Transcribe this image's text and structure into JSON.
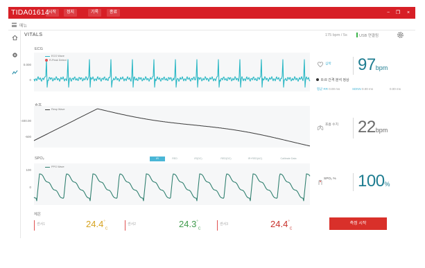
{
  "window": {
    "title": "TIDA01614",
    "menu": [
      "시작",
      "정지",
      "기록",
      "종료"
    ],
    "buttons": [
      "−",
      "❐",
      "×"
    ]
  },
  "toolbar": {
    "menu_label": "메뉴"
  },
  "header": {
    "title": "VITALS",
    "info": "175 bpm / 5s",
    "status": "USB 연결됨"
  },
  "nav_icons": [
    "home-icon",
    "settings-icon",
    "chart-icon"
  ],
  "colors": {
    "accent_red": "#d71f26",
    "ecg": "#29b7c4",
    "resp": "#3a3a3a",
    "spo2": "#2f7f6f",
    "teal": "#2a8fa9"
  },
  "ecg": {
    "label": "ECG",
    "legend": [
      "ECG Wave",
      "R-Peak Detect"
    ],
    "yticks": [
      "0.000",
      "0"
    ]
  },
  "resp": {
    "label": "호흡",
    "legend": [
      "Resp Wave"
    ],
    "yticks": [
      "-400.00",
      "-600"
    ]
  },
  "spo2": {
    "label": "SPO₂",
    "legend": [
      "PPG Wave"
    ],
    "yticks": [
      "100",
      "0"
    ],
    "tabs": [
      "IR",
      "RED",
      "IR(DC)",
      "RED(DC)",
      "IR+RED(AC)",
      "Calibrate Data"
    ]
  },
  "heart_rate": {
    "label": "심박",
    "value": "97",
    "unit": "bpm",
    "status": "R-R 간격 분석 정상",
    "metrics": [
      {
        "key": "평균 RR",
        "value": "0.00 ms"
      },
      {
        "key": "SDNN",
        "value": "0.00 ms"
      },
      {
        "key": "",
        "value": "0.00 ms"
      }
    ]
  },
  "respiration": {
    "label": "호흡 수치",
    "value": "22",
    "unit": "bpm"
  },
  "spo2_value": {
    "label": "SPO₂ %",
    "value": "100",
    "unit": "%"
  },
  "temperature": {
    "label": "체온",
    "sensors": [
      {
        "name": "센서1",
        "value": "24.4",
        "color": "#d6a21e"
      },
      {
        "name": "센서2",
        "value": "24.3",
        "color": "#3e9a4b"
      },
      {
        "name": "센서3",
        "value": "24.4",
        "color": "#c8302a"
      }
    ]
  },
  "action_button": {
    "label": "측정 시작"
  }
}
